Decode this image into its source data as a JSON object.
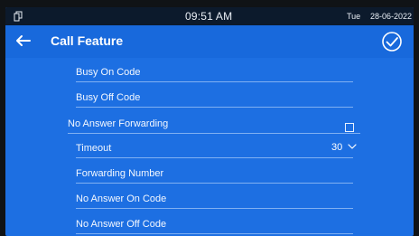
{
  "status_bar": {
    "time": "09:51 AM",
    "day": "Tue",
    "date": "28-06-2022"
  },
  "header": {
    "title": "Call Feature",
    "back_icon": "arrow-left-icon",
    "confirm_icon": "check-circle-icon"
  },
  "settings": {
    "busy_on_code_label": "Busy On Code",
    "busy_off_code_label": "Busy Off Code",
    "no_answer_forwarding_label": "No Answer Forwarding",
    "no_answer_forwarding_enabled": false,
    "timeout_label": "Timeout",
    "timeout_value": "30",
    "forwarding_number_label": "Forwarding Number",
    "no_answer_on_code_label": "No Answer On Code",
    "no_answer_off_code_label": "No Answer Off Code"
  },
  "colors": {
    "screen_background": "#1d6fe2",
    "header_background": "#1869dc",
    "status_bar_background": "#0c1a2c",
    "text": "#ffffff"
  }
}
